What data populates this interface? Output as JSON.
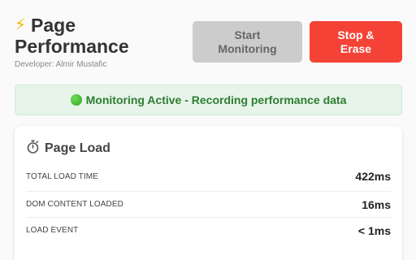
{
  "header": {
    "title_line1": "Page",
    "title_line2": "Performance",
    "developer": "Developer: Almir Mustafic",
    "icon": "lightning-bolt-icon"
  },
  "buttons": {
    "start_line1": "Start",
    "start_line2": "Monitoring",
    "stop_line1": "Stop &",
    "stop_line2": "Erase"
  },
  "status": {
    "text": "Monitoring Active - Recording performance data",
    "icon": "green-circle-icon",
    "color": "#2e7d32"
  },
  "page_load": {
    "title": "Page Load",
    "icon": "stopwatch-icon",
    "metrics": [
      {
        "label": "TOTAL LOAD TIME",
        "value": "422ms"
      },
      {
        "label": "DOM CONTENT LOADED",
        "value": "16ms"
      },
      {
        "label": "LOAD EVENT",
        "value": "< 1ms"
      }
    ]
  },
  "colors": {
    "stop_button": "#f44336",
    "start_button_disabled": "#cccccc",
    "status_background": "#e6f4e9"
  }
}
